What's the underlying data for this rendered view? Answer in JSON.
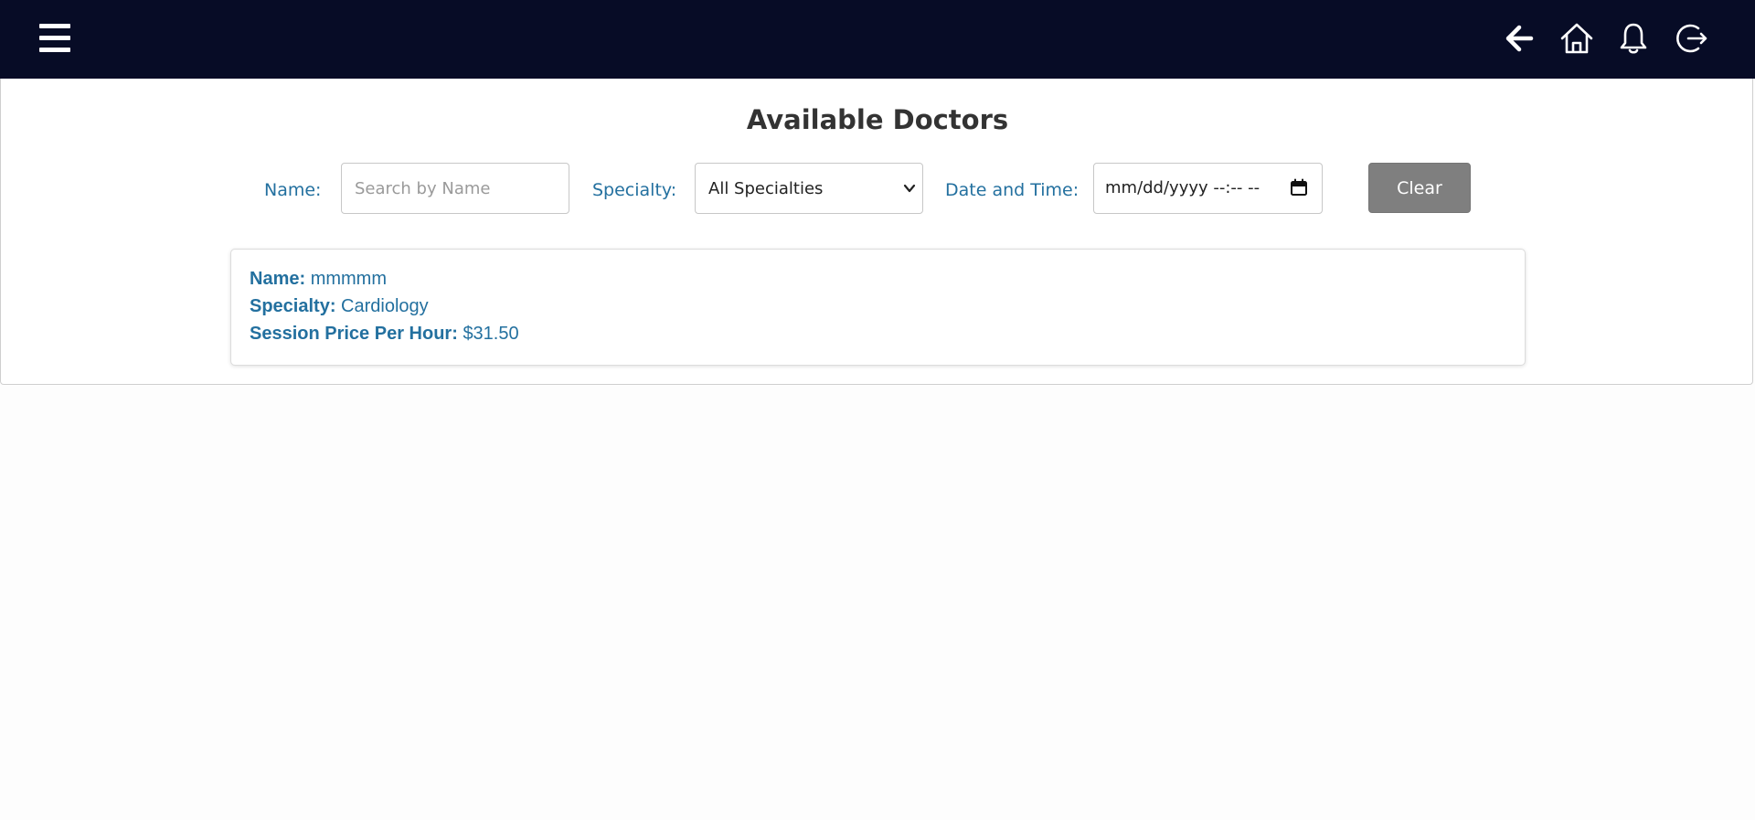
{
  "header": {
    "menu_icon": "hamburger-menu-icon",
    "actions": [
      {
        "name": "back",
        "icon": "arrow-left-icon"
      },
      {
        "name": "home",
        "icon": "home-icon"
      },
      {
        "name": "notifications",
        "icon": "bell-icon"
      },
      {
        "name": "logout",
        "icon": "logout-icon"
      }
    ],
    "background_color": "#070c26"
  },
  "page": {
    "title": "Available Doctors"
  },
  "filters": {
    "name_label": "Name:",
    "name_placeholder": "Search by Name",
    "name_value": "",
    "specialty_label": "Specialty:",
    "specialty_selected": "All Specialties",
    "datetime_label": "Date and Time:",
    "datetime_value": "mm/dd/yyyy --:-- --",
    "clear_label": "Clear"
  },
  "doctors": [
    {
      "name_label": "Name:",
      "name": "mmmmm",
      "specialty_label": "Specialty:",
      "specialty": "Cardiology",
      "price_label": "Session Price Per Hour:",
      "price": "$31.50"
    }
  ],
  "colors": {
    "label_blue": "#23709f",
    "button_gray": "#7f7f7f",
    "title_text": "#333333"
  }
}
